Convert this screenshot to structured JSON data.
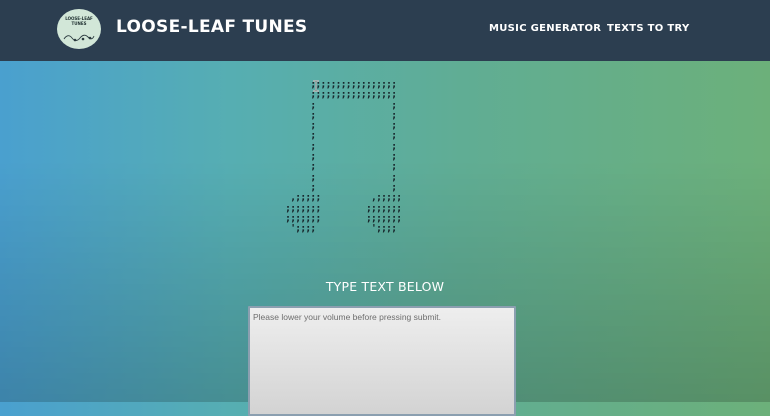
{
  "header": {
    "logo_text": "LOOSE-LEAF\nTUNES",
    "brand": "LOOSE-LEAF TUNES",
    "nav": {
      "generator": "MUSIC GENERATOR",
      "texts": "TEXTS TO TRY"
    }
  },
  "art": {
    "note_ascii": "      ;;;;;;;;;;;;;;;;;\n      ;;;;;;;;;;;;;;;;;\n      ;               ;\n      ;               ;\n      ;               ;\n      ;               ;\n      ;               ;\n      ;               ;\n      ;               ;\n      ;               ;\n      ;               ;\n  ,;;;;;          ,;;;;;\n ;;;;;;;         ;;;;;;;\n ;;;;;;;         ;;;;;;;\n  ';;;;           ';;;;"
  },
  "main": {
    "prompt": "TYPE TEXT BELOW",
    "input_placeholder": "Please lower your volume before pressing submit."
  }
}
